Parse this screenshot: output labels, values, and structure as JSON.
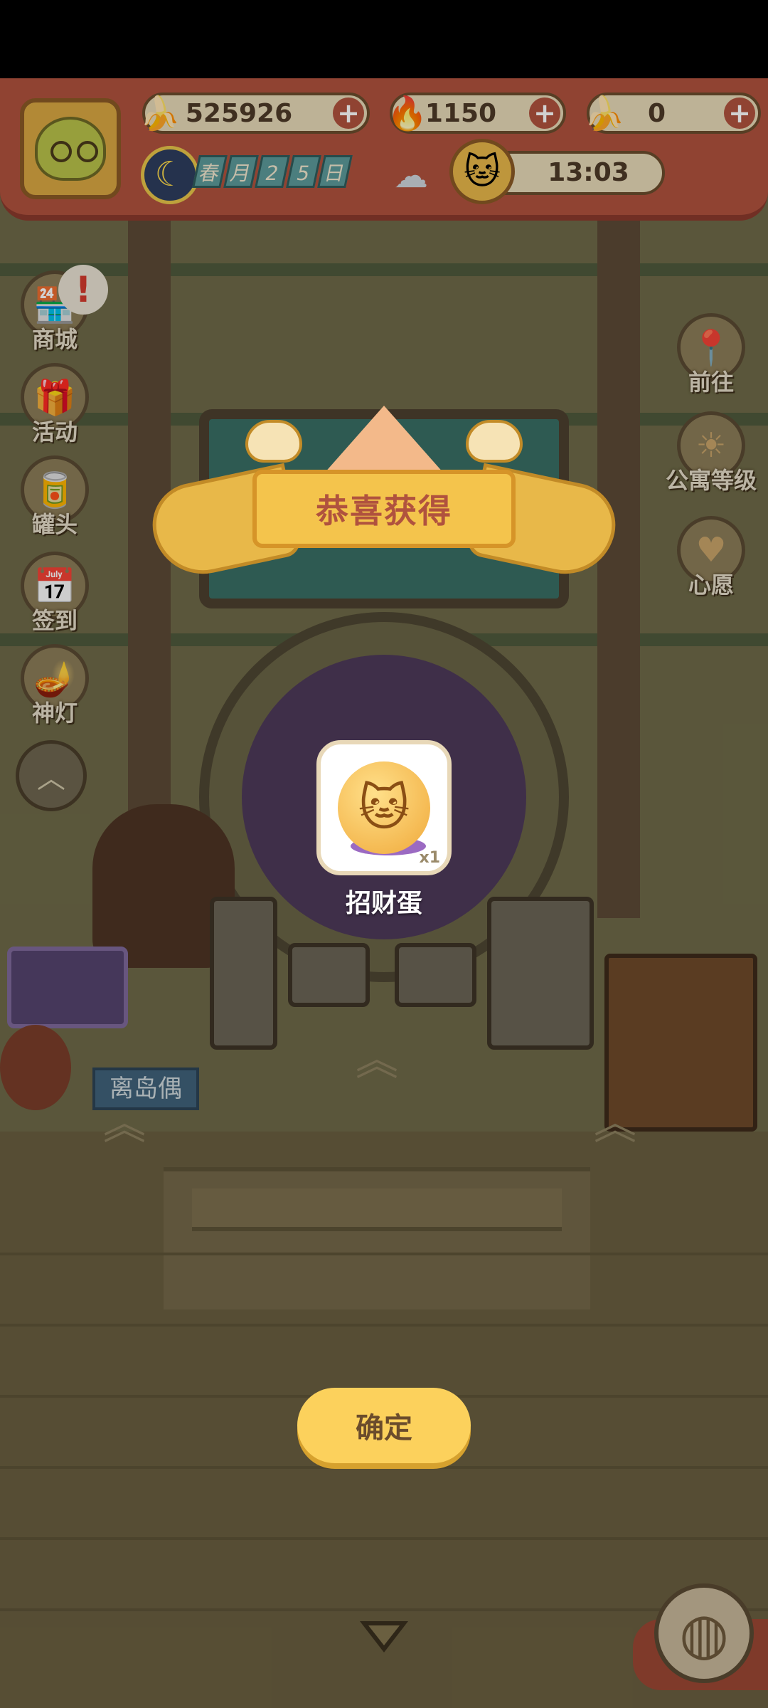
{
  "hud": {
    "bananas": "525926",
    "fire": "1150",
    "rare_banana": "0",
    "date_tiles": [
      "春",
      "月",
      "2",
      "5",
      "日"
    ],
    "time": "13:03"
  },
  "side_left": [
    {
      "label": "商城",
      "icon": "shop-icon"
    },
    {
      "label": "活动",
      "icon": "gift-icon"
    },
    {
      "label": "罐头",
      "icon": "can-icon"
    },
    {
      "label": "签到",
      "icon": "checkin-icon"
    },
    {
      "label": "神灯",
      "icon": "lamp-icon"
    }
  ],
  "side_right": [
    {
      "label": "前往",
      "icon": "map-icon"
    },
    {
      "label": "公寓等级",
      "icon": "sun-icon"
    },
    {
      "label": "心愿",
      "icon": "heart-book-icon"
    }
  ],
  "alert_badge": "!",
  "scene_sign": "离岛偶",
  "popup": {
    "title": "恭喜获得",
    "reward_name": "招财蛋",
    "reward_qty": "x1",
    "confirm_label": "确定"
  },
  "colors": {
    "hud_red": "#b0523e",
    "confirm_yellow": "#fcd15c",
    "ribbon_yellow": "#f4c44c"
  }
}
